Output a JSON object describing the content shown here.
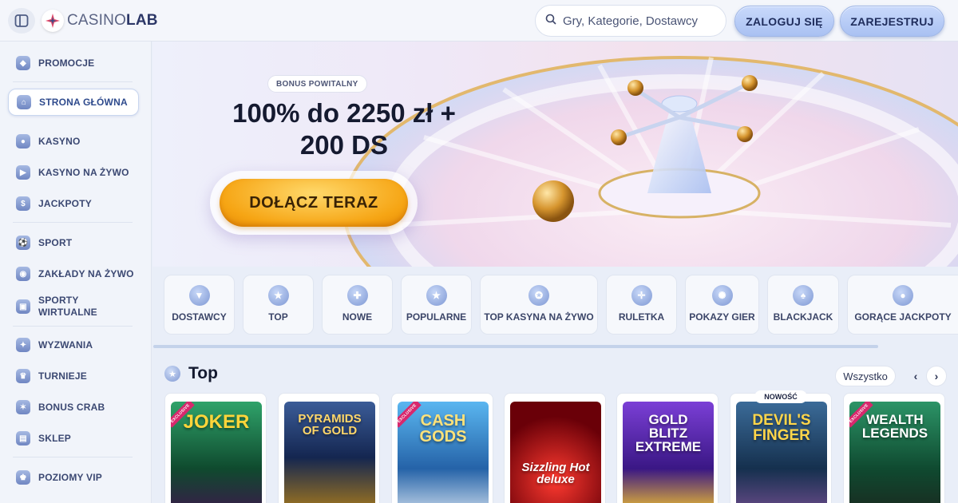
{
  "header": {
    "logo_left": "CASINO",
    "logo_right": "LAB",
    "search_placeholder": "Gry, Kategorie, Dostawcy",
    "login_label": "ZALOGUJ SIĘ",
    "register_label": "ZAREJESTRUJ"
  },
  "sidebar": {
    "items": [
      {
        "label": "PROMOCJE",
        "icon": "megaphone-icon"
      },
      {
        "label": "STRONA GŁÓWNA",
        "icon": "home-icon",
        "active": true
      },
      {
        "label": "KASYNO",
        "icon": "chip-icon"
      },
      {
        "label": "KASYNO NA ŻYWO",
        "icon": "live-icon"
      },
      {
        "label": "JACKPOTY",
        "icon": "jackpot-icon"
      },
      {
        "label": "SPORT",
        "icon": "football-icon"
      },
      {
        "label": "ZAKŁADY NA ŻYWO",
        "icon": "live-bet-icon"
      },
      {
        "label": "SPORTY WIRTUALNE",
        "icon": "virtual-sport-icon"
      },
      {
        "label": "WYZWANIA",
        "icon": "challenge-icon"
      },
      {
        "label": "TURNIEJE",
        "icon": "trophy-icon"
      },
      {
        "label": "BONUS CRAB",
        "icon": "crab-icon"
      },
      {
        "label": "SKLEP",
        "icon": "cart-icon"
      },
      {
        "label": "POZIOMY VIP",
        "icon": "crown-icon"
      }
    ]
  },
  "hero": {
    "badge": "BONUS POWITALNY",
    "title_line1": "100% do 2250 zł +",
    "title_line2": "200 DS",
    "cta": "DOŁĄCZ TERAZ"
  },
  "categories": [
    {
      "label": "DOSTAWCY",
      "icon": "funnel-icon"
    },
    {
      "label": "TOP",
      "icon": "star-badge-icon"
    },
    {
      "label": "NOWE",
      "icon": "new-icon"
    },
    {
      "label": "POPULARNE",
      "icon": "star-icon"
    },
    {
      "label": "TOP KASYNA NA ŻYWO",
      "icon": "medal-icon"
    },
    {
      "label": "RULETKA",
      "icon": "roulette-icon"
    },
    {
      "label": "POKAZY GIER",
      "icon": "wheel-icon"
    },
    {
      "label": "BLACKJACK",
      "icon": "card-icon"
    },
    {
      "label": "GORĄCE JACKPOTY",
      "icon": "coins-icon"
    }
  ],
  "top_section": {
    "title": "Top",
    "see_all": "Wszystko",
    "prev_icon": "‹",
    "next_icon": "›",
    "new_badge": "NOWOŚĆ",
    "exclusive_badge": "EXCLUSIVE",
    "games": [
      {
        "name": "JOKER",
        "exclusive": true,
        "bg": "#1f8a5a"
      },
      {
        "name": "PYRAMIDS OF GOLD",
        "exclusive": false,
        "bg": "#1f3e7a"
      },
      {
        "name": "CASH GODS",
        "exclusive": true,
        "bg": "#2e7bc4"
      },
      {
        "name": "Sizzling Hot deluxe",
        "exclusive": false,
        "bg": "#8e0a12"
      },
      {
        "name": "GOLD BLITZ EXTREME",
        "exclusive": false,
        "bg": "#5a2ea8"
      },
      {
        "name": "DEVIL'S FINGER",
        "exclusive": false,
        "new": true,
        "bg": "#1e4a70"
      },
      {
        "name": "WEALTH LEGENDS",
        "exclusive": true,
        "bg": "#1c6b48"
      }
    ]
  },
  "colors": {
    "accent": "#f6a514",
    "brand": "#2c3767"
  }
}
